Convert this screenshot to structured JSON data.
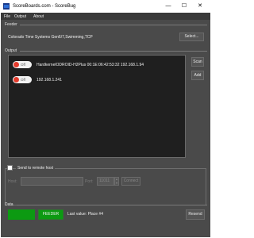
{
  "window": {
    "title": "ScoreBoards.com - ScoreBug",
    "min_glyph": "—",
    "max_glyph": "☐",
    "close_glyph": "✕"
  },
  "menu": [
    "File",
    "Output",
    "About"
  ],
  "feeder": {
    "section_label": "Feeder",
    "text": "Colorado Time Systems Gen6/7,Swimming,TCP",
    "select_button": "Select..."
  },
  "output": {
    "section_label": "Output",
    "rows": [
      {
        "toggle": "Off",
        "text": "HardkernelODROID-H2Plus 00:1E:06:42:53:32 192.168.1.94"
      },
      {
        "toggle": "Off",
        "text": "192.168.1.241"
      }
    ],
    "scan_button": "Scan",
    "add_button": "Add"
  },
  "remote": {
    "checkbox_label": "Send to remote host",
    "host_label": "Host:",
    "host_value": "",
    "port_label": "Port:",
    "port_value": "11011",
    "connect_button": "Connect"
  },
  "data_section": {
    "section_label": "Data",
    "feeder_button": "FEEDER",
    "last_value": "Last value:  Place #4",
    "resend_button": "Resend"
  },
  "colors": {
    "background": "#4a4a4a",
    "output_bg": "#1f1f1f",
    "accent_green": "#0c9a12",
    "toggle_off_red": "#e43b2c"
  }
}
